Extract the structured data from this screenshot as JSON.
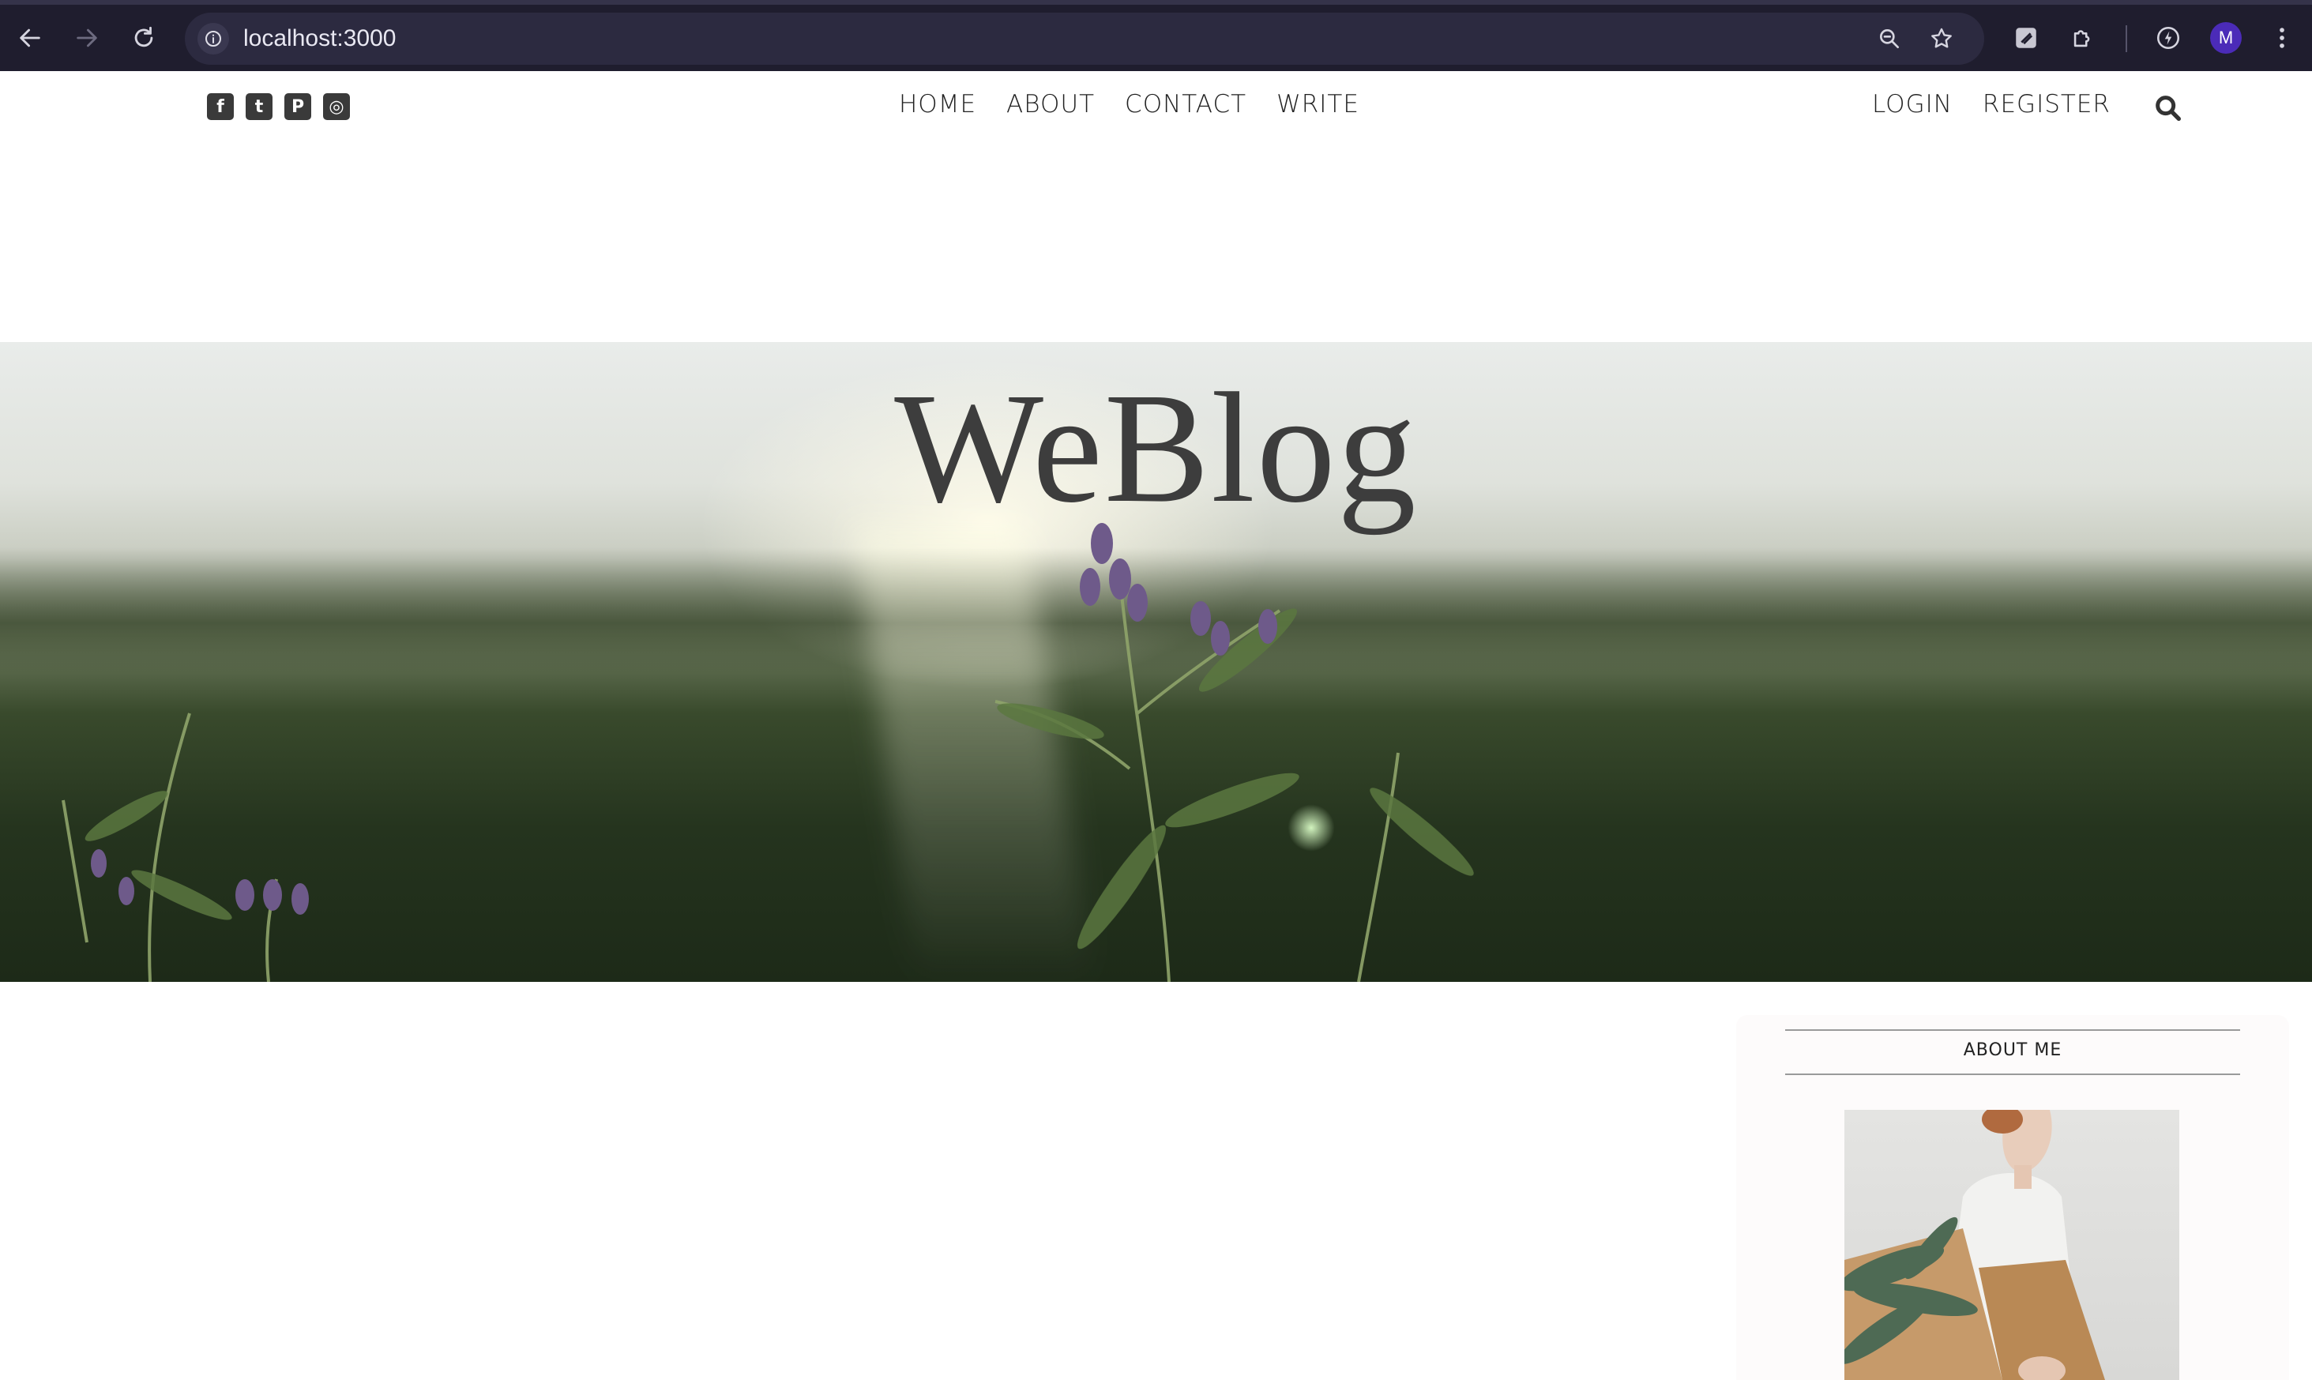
{
  "browser": {
    "url": "localhost:3000",
    "profile_initial": "M",
    "icons": {
      "back": "arrow-left-icon",
      "forward": "arrow-right-icon",
      "reload": "reload-icon",
      "site_info": "info-icon",
      "zoom": "zoom-icon",
      "bookmark": "star-icon",
      "extension_1": "extension-icon",
      "extensions": "puzzle-icon",
      "performance": "lightning-icon",
      "menu": "kebab-menu-icon"
    }
  },
  "site": {
    "social": [
      {
        "name": "facebook-icon",
        "glyph": "f"
      },
      {
        "name": "twitter-icon",
        "glyph": "t"
      },
      {
        "name": "pinterest-icon",
        "glyph": "P"
      },
      {
        "name": "instagram-icon",
        "glyph": "◎"
      }
    ],
    "nav": {
      "home": "HOME",
      "about": "ABOUT",
      "contact": "CONTACT",
      "write": "WRITE"
    },
    "auth": {
      "login": "LOGIN",
      "register": "REGISTER"
    },
    "search_icon": "search-icon",
    "hero_title": "WeBlog",
    "sidebar": {
      "title": "ABOUT ME"
    }
  },
  "colors": {
    "chrome_bg": "#1f1d2e",
    "omnibox_bg": "#2c2a40",
    "avatar_bg": "#4b2bb8",
    "text_dark": "#222222",
    "hero_title": "#3d3d3d"
  }
}
